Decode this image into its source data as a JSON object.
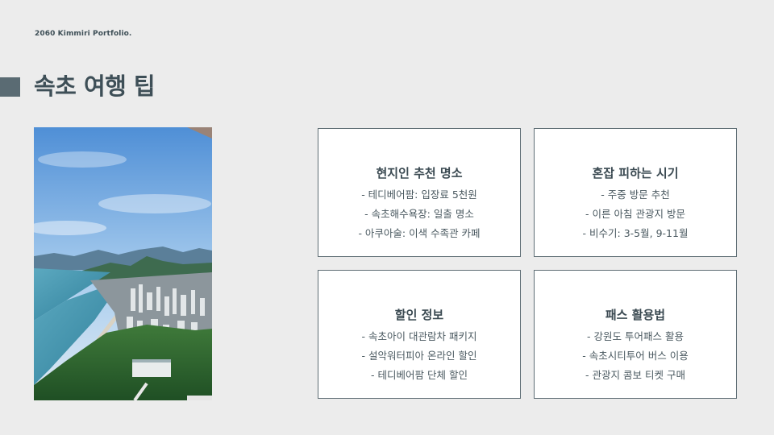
{
  "header": {
    "brand": "2060 Kimmiri Portfolio.",
    "title": "속초 여행 팁"
  },
  "colors": {
    "background": "#ececec",
    "accent": "#5a6b73",
    "text": "#3b4a52",
    "card_border": "#5f6e75"
  },
  "cards": [
    {
      "title": "현지인 추천 명소",
      "items": [
        "- 테디베어팜: 입장료 5천원",
        "- 속초해수욕장: 일출 명소",
        "- 아쿠아술: 이색 수족관 카페"
      ]
    },
    {
      "title": "혼잡 피하는 시기",
      "items": [
        "- 주중 방문 추천",
        "- 이른 아침 관광지 방문",
        "- 비수기: 3-5월, 9-11월"
      ]
    },
    {
      "title": "할인 정보",
      "items": [
        "- 속초아이 대관람차 패키지",
        "- 설악워터피아 온라인 할인",
        "- 테디베어팜 단체 할인"
      ]
    },
    {
      "title": "패스 활용법",
      "items": [
        "- 강원도 투어패스 활용",
        "- 속초시티투어 버스 이용",
        "- 관광지 콤보 티켓 구매"
      ]
    }
  ]
}
